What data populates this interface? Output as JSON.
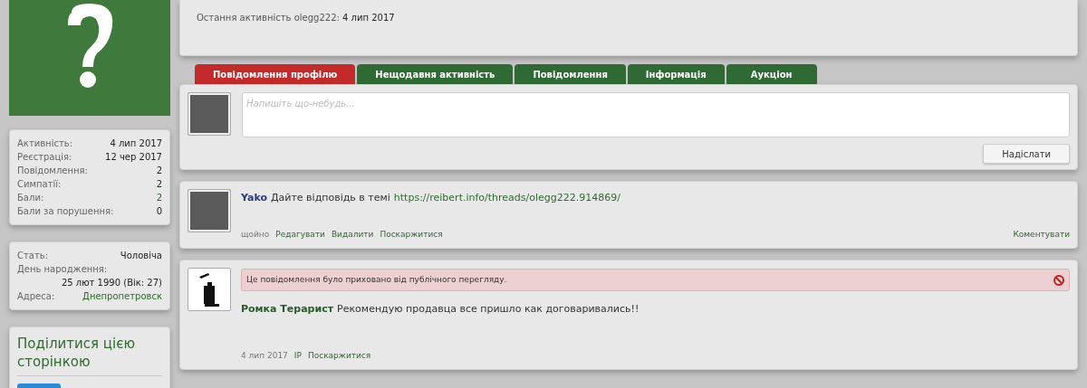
{
  "last_activity": {
    "label": "Остання активність olegg222:",
    "value": "4 лип 2017"
  },
  "stats": [
    {
      "label": "Активність:",
      "value": "4 лип 2017",
      "link": false
    },
    {
      "label": "Реєстрація:",
      "value": "12 чер 2017",
      "link": false
    },
    {
      "label": "Повідомлення:",
      "value": "2",
      "link": false
    },
    {
      "label": "Симпатії:",
      "value": "2",
      "link": false
    },
    {
      "label": "Бали:",
      "value": "2",
      "link": true
    },
    {
      "label": "Бали за порушення:",
      "value": "0",
      "link": false
    }
  ],
  "info": [
    {
      "label": "Стать:",
      "value": "Чоловіча",
      "link": false,
      "stacked": false
    },
    {
      "label": "День народження:",
      "value": "25 лют 1990 (Вік: 27)",
      "link": false,
      "stacked": true
    },
    {
      "label": "Адреса:",
      "value": "Днепропетровск",
      "link": true,
      "stacked": false
    }
  ],
  "share": {
    "title": "Поділитися цією сторінкою"
  },
  "tabs": [
    {
      "label": "Повідомлення профілю",
      "selected": true
    },
    {
      "label": "Нещодавня активність",
      "selected": false
    },
    {
      "label": "Повідомлення",
      "selected": false
    },
    {
      "label": "Інформація",
      "selected": false
    },
    {
      "label": "Аукціон",
      "selected": false
    }
  ],
  "composer": {
    "placeholder": "Напишіть що-небудь...",
    "button": "Надіслати"
  },
  "posts": [
    {
      "kind": "photo",
      "author": "Yako",
      "color": "#2a3a7a",
      "text": "Дайте відповідь в темі",
      "link": "https://reibert.info/threads/olegg222.914869/",
      "meta": [
        {
          "text": "щойно",
          "kind": "plain"
        },
        {
          "text": "Редагувати",
          "kind": "link"
        },
        {
          "text": "Видалити",
          "kind": "link"
        },
        {
          "text": "Поскаржитися",
          "kind": "link"
        }
      ],
      "comment": "Коментувати"
    },
    {
      "kind": "drawing",
      "author": "Ромка Терарист",
      "color": "#2a5a2a",
      "text": "Рекомендую продавца все пришло как договаривались!!",
      "hidden_notice": "Це повідомлення було приховано від публічного перегляду.",
      "meta": [
        {
          "text": "4 лип 2017",
          "kind": "plain"
        },
        {
          "text": "IP",
          "kind": "link"
        },
        {
          "text": "Поскаржитися",
          "kind": "link"
        }
      ]
    }
  ]
}
